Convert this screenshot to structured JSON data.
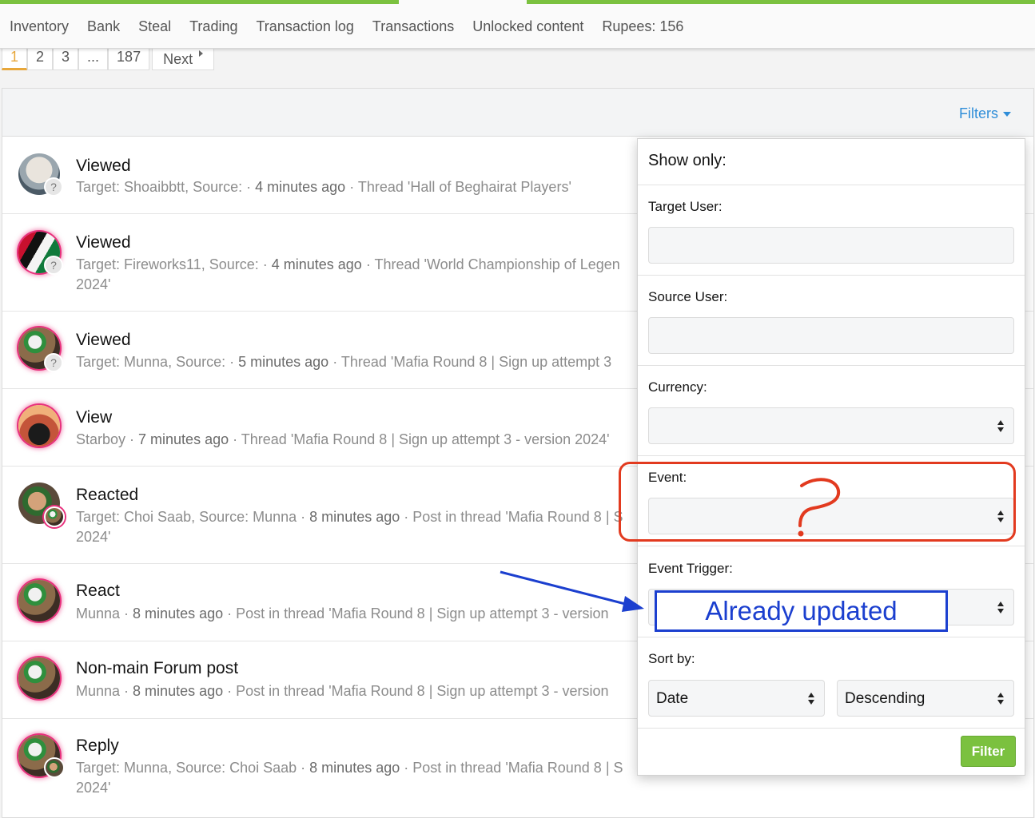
{
  "nav": {
    "items": [
      "Inventory",
      "Bank",
      "Steal",
      "Trading",
      "Transaction log",
      "Transactions",
      "Unlocked content",
      "Rupees: 156"
    ]
  },
  "pagination": {
    "pages": [
      "1",
      "2",
      "3",
      "...",
      "187"
    ],
    "current": "1",
    "next_label": "Next"
  },
  "filters_label": "Filters",
  "rows": [
    {
      "title": "Viewed",
      "meta_prefix": "Target: Shoaibbtt, Source: · ",
      "time": "4 minutes ago",
      "meta_suffix": " · Thread 'Hall of Beghairat Players'",
      "meta_line2": ""
    },
    {
      "title": "Viewed",
      "meta_prefix": "Target: Fireworks11, Source: · ",
      "time": "4 minutes ago",
      "meta_suffix": " · Thread 'World Championship of Legen",
      "meta_line2": "2024'"
    },
    {
      "title": "Viewed",
      "meta_prefix": "Target: Munna, Source: · ",
      "time": "5 minutes ago",
      "meta_suffix": " · Thread 'Mafia Round 8 | Sign up attempt 3",
      "meta_line2": ""
    },
    {
      "title": "View",
      "meta_prefix": "Starboy · ",
      "time": "7 minutes ago",
      "meta_suffix": " · Thread 'Mafia Round 8 | Sign up attempt 3 - version 2024'",
      "meta_line2": ""
    },
    {
      "title": "Reacted",
      "meta_prefix": "Target: Choi Saab, Source: Munna · ",
      "time": "8 minutes ago",
      "meta_suffix": " · Post in thread 'Mafia Round 8 | S",
      "meta_line2": "2024'"
    },
    {
      "title": "React",
      "meta_prefix": "Munna · ",
      "time": "8 minutes ago",
      "meta_suffix": " · Post in thread 'Mafia Round 8 | Sign up attempt 3 - version",
      "meta_line2": ""
    },
    {
      "title": "Non-main Forum post",
      "meta_prefix": "Munna · ",
      "time": "8 minutes ago",
      "meta_suffix": " · Post in thread 'Mafia Round 8 | Sign up attempt 3 - version",
      "meta_line2": ""
    },
    {
      "title": "Reply",
      "meta_prefix": "Target: Munna, Source: Choi Saab · ",
      "time": "8 minutes ago",
      "meta_suffix": " · Post in thread 'Mafia Round 8 | S",
      "meta_line2": "2024'"
    }
  ],
  "menu": {
    "header": "Show only:",
    "target_user_label": "Target User:",
    "source_user_label": "Source User:",
    "currency_label": "Currency:",
    "event_label": "Event:",
    "event_trigger_label": "Event Trigger:",
    "sort_by_label": "Sort by:",
    "sort_field": "Date",
    "sort_order": "Descending",
    "filter_button": "Filter"
  },
  "annotation": {
    "blue_text": "Already updated"
  }
}
